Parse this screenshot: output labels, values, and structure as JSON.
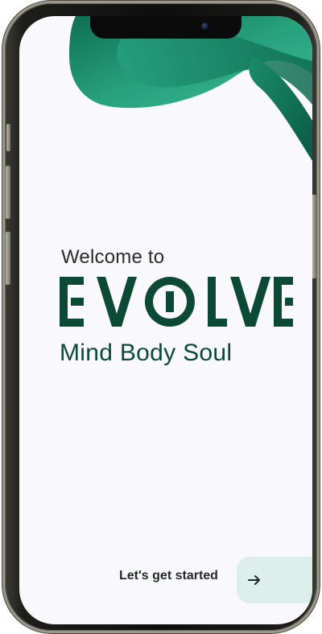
{
  "device": {
    "type": "phone-mockup"
  },
  "welcome": {
    "prefix": "Welcome to"
  },
  "brand": {
    "name": "EVOLVE",
    "tagline": "Mind Body Soul"
  },
  "cta": {
    "label": "Let's get started",
    "icon": "arrow-right-icon"
  },
  "colors": {
    "brand_green": "#0d4a36",
    "wave_light": "#2eaa86",
    "wave_dark": "#127a5c",
    "cta_bg": "#dcefeb",
    "screen_bg": "#f9f8fc"
  }
}
